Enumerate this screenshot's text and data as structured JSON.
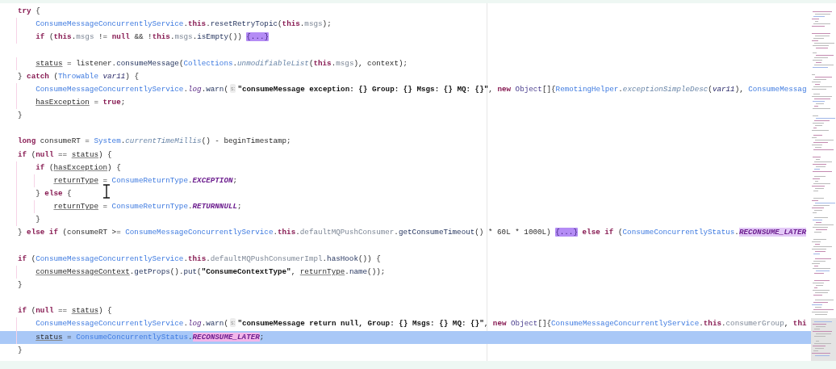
{
  "editor": {
    "lines": [
      {
        "selected": false,
        "tokens": [
          {
            "text": "try",
            "kind": "keyword"
          },
          {
            "text": " {",
            "kind": "plain"
          }
        ]
      },
      {
        "selected": false,
        "tokens": [
          {
            "text": "    ConsumeMessageConcurrentlyService",
            "kind": "class"
          },
          {
            "text": ".",
            "kind": "plain"
          },
          {
            "text": "this",
            "kind": "keyword"
          },
          {
            "text": ".",
            "kind": "plain"
          },
          {
            "text": "resetRetryTopic",
            "kind": "method"
          },
          {
            "text": "(",
            "kind": "plain"
          },
          {
            "text": "this",
            "kind": "keyword"
          },
          {
            "text": ".",
            "kind": "plain"
          },
          {
            "text": "msgs",
            "kind": "field"
          },
          {
            "text": ");",
            "kind": "plain"
          }
        ]
      },
      {
        "selected": false,
        "tokens": [
          {
            "text": "    if",
            "kind": "keyword"
          },
          {
            "text": " (",
            "kind": "plain"
          },
          {
            "text": "this",
            "kind": "keyword"
          },
          {
            "text": ".",
            "kind": "plain"
          },
          {
            "text": "msgs",
            "kind": "field"
          },
          {
            "text": " != ",
            "kind": "plain"
          },
          {
            "text": "null",
            "kind": "keyword"
          },
          {
            "text": " && !",
            "kind": "plain"
          },
          {
            "text": "this",
            "kind": "keyword"
          },
          {
            "text": ".",
            "kind": "plain"
          },
          {
            "text": "msgs",
            "kind": "field"
          },
          {
            "text": ".",
            "kind": "plain"
          },
          {
            "text": "isEmpty",
            "kind": "method"
          },
          {
            "text": "()) ",
            "kind": "plain"
          },
          {
            "text": "{...}",
            "kind": "fold"
          }
        ]
      },
      {
        "selected": false
      },
      {
        "selected": false,
        "tokens": [
          {
            "text": "    status",
            "kind": "reassigned"
          },
          {
            "text": " = listener.",
            "kind": "plain"
          },
          {
            "text": "consumeMessage",
            "kind": "method"
          },
          {
            "text": "(",
            "kind": "plain"
          },
          {
            "text": "Collections",
            "kind": "class"
          },
          {
            "text": ".",
            "kind": "plain"
          },
          {
            "text": "unmodifiableList",
            "kind": "static_method"
          },
          {
            "text": "(",
            "kind": "plain"
          },
          {
            "text": "this",
            "kind": "keyword"
          },
          {
            "text": ".",
            "kind": "plain"
          },
          {
            "text": "msgs",
            "kind": "field"
          },
          {
            "text": "), context);",
            "kind": "plain"
          }
        ]
      },
      {
        "selected": false,
        "tokens": [
          {
            "text": "} ",
            "kind": "plain"
          },
          {
            "text": "catch",
            "kind": "keyword"
          },
          {
            "text": " (",
            "kind": "plain"
          },
          {
            "text": "Throwable ",
            "kind": "class"
          },
          {
            "text": "var11",
            "kind": "param"
          },
          {
            "text": ") {",
            "kind": "plain"
          }
        ]
      },
      {
        "selected": false,
        "tokens": [
          {
            "text": "    ConsumeMessageConcurrentlyService",
            "kind": "class"
          },
          {
            "text": ".",
            "kind": "plain"
          },
          {
            "text": "log",
            "kind": "static_field"
          },
          {
            "text": ".",
            "kind": "plain"
          },
          {
            "text": "warn",
            "kind": "method"
          },
          {
            "text": "(",
            "kind": "plain"
          },
          {
            "text": "s:",
            "kind": "hint"
          },
          {
            "text": "\"consumeMessage exception: {} Group: {} Msgs: {} MQ: {}\"",
            "kind": "string"
          },
          {
            "text": ", ",
            "kind": "plain"
          },
          {
            "text": "new ",
            "kind": "keyword"
          },
          {
            "text": "Object",
            "kind": "type"
          },
          {
            "text": "[]{",
            "kind": "plain"
          },
          {
            "text": "RemotingHelper",
            "kind": "class"
          },
          {
            "text": ".",
            "kind": "plain"
          },
          {
            "text": "exceptionSimpleDesc",
            "kind": "static_method"
          },
          {
            "text": "(",
            "kind": "plain"
          },
          {
            "text": "var11",
            "kind": "param"
          },
          {
            "text": "), ",
            "kind": "plain"
          },
          {
            "text": "ConsumeMessag",
            "kind": "class"
          }
        ]
      },
      {
        "selected": false,
        "tokens": [
          {
            "text": "    hasException",
            "kind": "reassigned"
          },
          {
            "text": " = ",
            "kind": "plain"
          },
          {
            "text": "true",
            "kind": "keyword"
          },
          {
            "text": ";",
            "kind": "plain"
          }
        ]
      },
      {
        "selected": false,
        "tokens": [
          {
            "text": "}",
            "kind": "plain"
          }
        ]
      },
      {
        "selected": false
      },
      {
        "selected": false,
        "tokens": [
          {
            "text": "long",
            "kind": "keyword"
          },
          {
            "text": " consumeRT = ",
            "kind": "plain"
          },
          {
            "text": "System",
            "kind": "class"
          },
          {
            "text": ".",
            "kind": "plain"
          },
          {
            "text": "currentTimeMillis",
            "kind": "static_method"
          },
          {
            "text": "() - beginTimestamp;",
            "kind": "plain"
          }
        ]
      },
      {
        "selected": false,
        "tokens": [
          {
            "text": "if",
            "kind": "keyword"
          },
          {
            "text": " (",
            "kind": "plain"
          },
          {
            "text": "null",
            "kind": "keyword"
          },
          {
            "text": " == ",
            "kind": "plain"
          },
          {
            "text": "status",
            "kind": "reassigned"
          },
          {
            "text": ") {",
            "kind": "plain"
          }
        ]
      },
      {
        "selected": false,
        "tokens": [
          {
            "text": "    if",
            "kind": "keyword"
          },
          {
            "text": " (",
            "kind": "plain"
          },
          {
            "text": "hasException",
            "kind": "reassigned"
          },
          {
            "text": ") {",
            "kind": "plain"
          }
        ]
      },
      {
        "selected": false,
        "tokens": [
          {
            "text": "        returnType",
            "kind": "reassigned"
          },
          {
            "text": " = ",
            "kind": "plain"
          },
          {
            "text": "ConsumeReturnType",
            "kind": "class"
          },
          {
            "text": ".",
            "kind": "plain"
          },
          {
            "text": "EXCEPTION",
            "kind": "constant"
          },
          {
            "text": ";",
            "kind": "plain"
          }
        ]
      },
      {
        "selected": false,
        "tokens": [
          {
            "text": "    } ",
            "kind": "plain"
          },
          {
            "text": "else",
            "kind": "keyword"
          },
          {
            "text": " {",
            "kind": "plain"
          }
        ]
      },
      {
        "selected": false,
        "tokens": [
          {
            "text": "        returnType",
            "kind": "reassigned"
          },
          {
            "text": " = ",
            "kind": "plain"
          },
          {
            "text": "ConsumeReturnType",
            "kind": "class"
          },
          {
            "text": ".",
            "kind": "plain"
          },
          {
            "text": "RETURNNULL",
            "kind": "constant"
          },
          {
            "text": ";",
            "kind": "plain"
          }
        ]
      },
      {
        "selected": false,
        "tokens": [
          {
            "text": "    }",
            "kind": "plain"
          }
        ]
      },
      {
        "selected": false,
        "tokens": [
          {
            "text": "} ",
            "kind": "plain"
          },
          {
            "text": "else if",
            "kind": "keyword"
          },
          {
            "text": " (consumeRT >= ",
            "kind": "plain"
          },
          {
            "text": "ConsumeMessageConcurrentlyService",
            "kind": "class"
          },
          {
            "text": ".",
            "kind": "plain"
          },
          {
            "text": "this",
            "kind": "keyword"
          },
          {
            "text": ".",
            "kind": "plain"
          },
          {
            "text": "defaultMQPushConsumer",
            "kind": "field"
          },
          {
            "text": ".",
            "kind": "plain"
          },
          {
            "text": "getConsumeTimeout",
            "kind": "method"
          },
          {
            "text": "() * 60L * 1000L) ",
            "kind": "plain"
          },
          {
            "text": "{...}",
            "kind": "fold"
          },
          {
            "text": " else if",
            "kind": "keyword"
          },
          {
            "text": " (",
            "kind": "plain"
          },
          {
            "text": "ConsumeConcurrentlyStatus",
            "kind": "class"
          },
          {
            "text": ".",
            "kind": "plain"
          },
          {
            "text": "RECONSUME_LATER",
            "kind": "constant",
            "highlighted": true
          }
        ]
      },
      {
        "selected": false
      },
      {
        "selected": false,
        "tokens": [
          {
            "text": "if",
            "kind": "keyword"
          },
          {
            "text": " (",
            "kind": "plain"
          },
          {
            "text": "ConsumeMessageConcurrentlyService",
            "kind": "class"
          },
          {
            "text": ".",
            "kind": "plain"
          },
          {
            "text": "this",
            "kind": "keyword"
          },
          {
            "text": ".",
            "kind": "plain"
          },
          {
            "text": "defaultMQPushConsumerImpl",
            "kind": "field"
          },
          {
            "text": ".",
            "kind": "plain"
          },
          {
            "text": "hasHook",
            "kind": "method"
          },
          {
            "text": "()) {",
            "kind": "plain"
          }
        ]
      },
      {
        "selected": false,
        "tokens": [
          {
            "text": "    consumeMessageContext",
            "kind": "reassigned"
          },
          {
            "text": ".",
            "kind": "plain"
          },
          {
            "text": "getProps",
            "kind": "method"
          },
          {
            "text": "().",
            "kind": "plain"
          },
          {
            "text": "put",
            "kind": "method"
          },
          {
            "text": "(",
            "kind": "plain"
          },
          {
            "text": "\"ConsumeContextType\"",
            "kind": "string"
          },
          {
            "text": ", ",
            "kind": "plain"
          },
          {
            "text": "returnType",
            "kind": "reassigned"
          },
          {
            "text": ".",
            "kind": "plain"
          },
          {
            "text": "name",
            "kind": "method"
          },
          {
            "text": "());",
            "kind": "plain"
          }
        ]
      },
      {
        "selected": false,
        "tokens": [
          {
            "text": "}",
            "kind": "plain"
          }
        ]
      },
      {
        "selected": false
      },
      {
        "selected": false,
        "tokens": [
          {
            "text": "if",
            "kind": "keyword"
          },
          {
            "text": " (",
            "kind": "plain"
          },
          {
            "text": "null",
            "kind": "keyword"
          },
          {
            "text": " == ",
            "kind": "plain"
          },
          {
            "text": "status",
            "kind": "reassigned"
          },
          {
            "text": ") {",
            "kind": "plain"
          }
        ]
      },
      {
        "selected": false,
        "tokens": [
          {
            "text": "    ConsumeMessageConcurrentlyService",
            "kind": "class"
          },
          {
            "text": ".",
            "kind": "plain"
          },
          {
            "text": "log",
            "kind": "static_field"
          },
          {
            "text": ".",
            "kind": "plain"
          },
          {
            "text": "warn",
            "kind": "method"
          },
          {
            "text": "(",
            "kind": "plain"
          },
          {
            "text": "s:",
            "kind": "hint"
          },
          {
            "text": "\"consumeMessage return null, Group: {} Msgs: {} MQ: {}\"",
            "kind": "string"
          },
          {
            "text": ", ",
            "kind": "plain"
          },
          {
            "text": "new ",
            "kind": "keyword"
          },
          {
            "text": "Object",
            "kind": "type"
          },
          {
            "text": "[]{",
            "kind": "plain"
          },
          {
            "text": "ConsumeMessageConcurrentlyService",
            "kind": "class"
          },
          {
            "text": ".",
            "kind": "plain"
          },
          {
            "text": "this",
            "kind": "keyword"
          },
          {
            "text": ".",
            "kind": "plain"
          },
          {
            "text": "consumerGroup",
            "kind": "field"
          },
          {
            "text": ", ",
            "kind": "plain"
          },
          {
            "text": "thi",
            "kind": "keyword"
          }
        ]
      },
      {
        "selected": true,
        "tokens": [
          {
            "text": "    status",
            "kind": "reassigned"
          },
          {
            "text": " = ",
            "kind": "plain"
          },
          {
            "text": "ConsumeConcurrentlyStatus",
            "kind": "class"
          },
          {
            "text": ".",
            "kind": "plain"
          },
          {
            "text": "RECONSUME_LATER",
            "kind": "constant",
            "highlighted": true
          },
          {
            "text": ";",
            "kind": "plain"
          }
        ]
      },
      {
        "selected": false,
        "tokens": [
          {
            "text": "}",
            "kind": "plain"
          }
        ]
      }
    ]
  }
}
